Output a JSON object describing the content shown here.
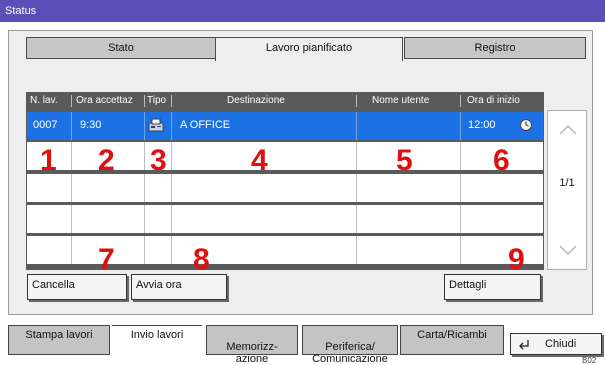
{
  "window": {
    "title": "Status"
  },
  "top_tabs": [
    {
      "label": "Stato"
    },
    {
      "label": "Lavoro pianificato",
      "active": true
    },
    {
      "label": "Registro"
    }
  ],
  "table": {
    "headers": [
      "N. lav.",
      "Ora accettaz",
      "Tipo",
      "Destinazione",
      "Nome utente",
      "Ora di inizio"
    ],
    "selected_row": {
      "job_no": "0007",
      "accept_time": "9:30",
      "type_icon": "fax-icon",
      "destination": "A OFFICE",
      "user": "",
      "start_time": "12:00",
      "status_icon": "clock-icon"
    },
    "empty_rows": 4
  },
  "callouts": [
    "1",
    "2",
    "3",
    "4",
    "5",
    "6",
    "7",
    "8",
    "9"
  ],
  "pager": {
    "indicator": "1/1"
  },
  "buttons": {
    "cancel": "Cancella",
    "start_now": "Avvia ora",
    "details": "Dettagli"
  },
  "bottom_tabs": [
    {
      "label": "Stampa lavori"
    },
    {
      "label": "Invio lavori",
      "active": true
    },
    {
      "label": "Memorizz-\nazione"
    },
    {
      "label": "Periferica/\nComunicazione"
    },
    {
      "label": "Carta/Ricambi"
    }
  ],
  "close_button": {
    "label": "Chiudi"
  },
  "code": "B02"
}
